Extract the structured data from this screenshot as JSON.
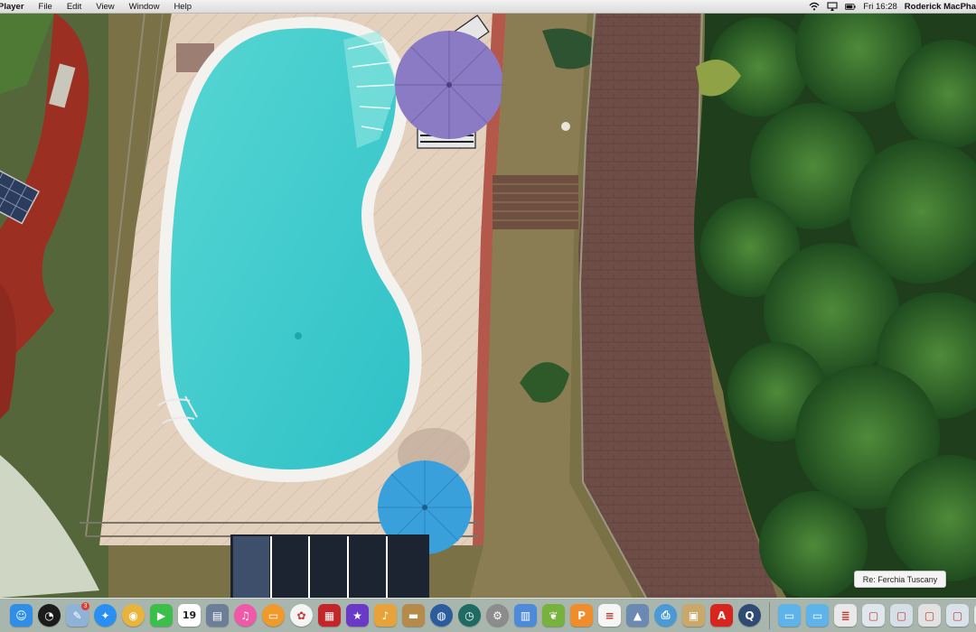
{
  "menubar": {
    "app_name": "Player",
    "menus": [
      "File",
      "Edit",
      "View",
      "Window",
      "Help"
    ],
    "clock": "Fri 16:28",
    "user": "Roderick MacPha"
  },
  "tooltip": {
    "text": "Re: Ferchia Tuscany"
  },
  "dock": {
    "items": [
      {
        "name": "finder",
        "icon": "finder-icon",
        "color": "#2f8fe8"
      },
      {
        "name": "dashboard",
        "icon": "dashboard-icon",
        "color": "#1b1b1b"
      },
      {
        "name": "preview",
        "icon": "preview-icon",
        "color": "#8fb2d6",
        "badge": "3"
      },
      {
        "name": "safari",
        "icon": "safari-icon",
        "color": "#2a8ff2"
      },
      {
        "name": "chrome",
        "icon": "chrome-icon",
        "color": "#e9b43c"
      },
      {
        "name": "facetime",
        "icon": "facetime-icon",
        "color": "#3bbf4a"
      },
      {
        "name": "calendar",
        "icon": "calendar-icon",
        "color": "#ffffff",
        "label": "19"
      },
      {
        "name": "photo-slideshow",
        "icon": "photos-stack-icon",
        "color": "#6d7f98"
      },
      {
        "name": "itunes",
        "icon": "itunes-icon",
        "color": "#ee5aa7"
      },
      {
        "name": "ibooks",
        "icon": "ibooks-icon",
        "color": "#f09a2c"
      },
      {
        "name": "photos",
        "icon": "photos-icon",
        "color": "#f4f4f4"
      },
      {
        "name": "photo-booth",
        "icon": "photo-booth-icon",
        "color": "#c4252b"
      },
      {
        "name": "imovie",
        "icon": "imovie-icon",
        "color": "#6a39c8"
      },
      {
        "name": "garageband",
        "icon": "garageband-icon",
        "color": "#e7a33a"
      },
      {
        "name": "notes-folder",
        "icon": "folder-brown-icon",
        "color": "#b68a48"
      },
      {
        "name": "google-earth",
        "icon": "google-earth-icon",
        "color": "#2b5c9d"
      },
      {
        "name": "time-machine",
        "icon": "time-machine-icon",
        "color": "#1d6b62"
      },
      {
        "name": "system-preferences",
        "icon": "gear-icon",
        "color": "#8c8c8c"
      },
      {
        "name": "spreadsheet",
        "icon": "numbers-icon",
        "color": "#4d8ad9"
      },
      {
        "name": "plant-app",
        "icon": "leaf-icon",
        "color": "#77b23d"
      },
      {
        "name": "pages",
        "icon": "pages-icon",
        "color": "#f08c2a"
      },
      {
        "name": "textedit",
        "icon": "textedit-icon",
        "color": "#f5f5f5"
      },
      {
        "name": "photo-app",
        "icon": "landscape-icon",
        "color": "#6b8ab3"
      },
      {
        "name": "printer",
        "icon": "printer-icon",
        "color": "#4a9ad8"
      },
      {
        "name": "preview-2",
        "icon": "image-viewer-icon",
        "color": "#c9a86a"
      },
      {
        "name": "acrobat",
        "icon": "acrobat-icon",
        "color": "#d8261f"
      },
      {
        "name": "quicktime",
        "icon": "quicktime-icon",
        "color": "#2f4b73"
      }
    ],
    "trailing": [
      {
        "name": "applications-folder",
        "icon": "folder-icon",
        "color": "#5eb3ea"
      },
      {
        "name": "downloads-folder",
        "icon": "folder-icon",
        "color": "#5eb3ea"
      },
      {
        "name": "document-stack",
        "icon": "document-icon",
        "color": "#e9e9e9"
      },
      {
        "name": "minimized-window-1",
        "icon": "window-thumb-icon",
        "color": "#dfe6ec"
      },
      {
        "name": "minimized-window-2",
        "icon": "window-thumb-icon",
        "color": "#d7dfe6"
      },
      {
        "name": "minimized-window-3",
        "icon": "window-thumb-icon",
        "color": "#e2e2e2"
      },
      {
        "name": "minimized-window-4",
        "icon": "window-thumb-icon",
        "color": "#d9e2ea"
      },
      {
        "name": "minimized-window-5",
        "icon": "window-thumb-icon",
        "color": "#e5e8ea"
      }
    ]
  }
}
